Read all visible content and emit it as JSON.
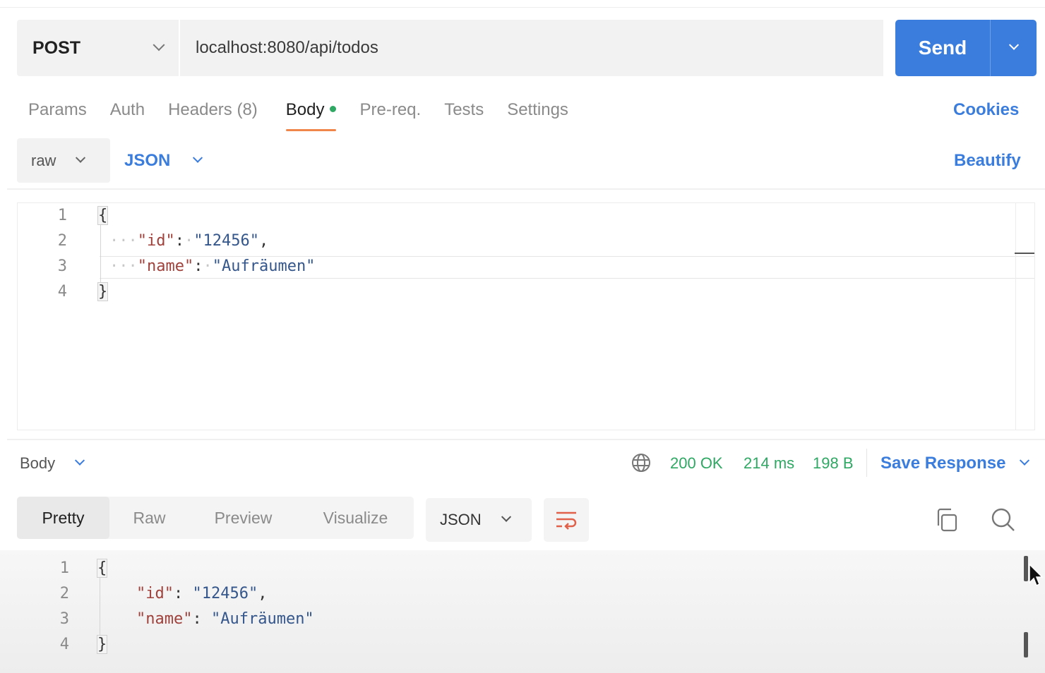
{
  "request": {
    "method": "POST",
    "url": "localhost:8080/api/todos",
    "send_label": "Send"
  },
  "request_tabs": [
    {
      "label": "Params",
      "active": false
    },
    {
      "label": "Auth",
      "active": false
    },
    {
      "label": "Headers (8)",
      "active": false
    },
    {
      "label": "Body",
      "active": true,
      "indicator_color": "#2fa864"
    },
    {
      "label": "Pre-req.",
      "active": false
    },
    {
      "label": "Tests",
      "active": false
    },
    {
      "label": "Settings",
      "active": false
    }
  ],
  "cookies_label": "Cookies",
  "body_options": {
    "mode": "raw",
    "language": "JSON",
    "beautify_label": "Beautify"
  },
  "request_body": {
    "line_numbers": [
      "1",
      "2",
      "3",
      "4"
    ],
    "open_brace": "{",
    "close_brace": "}",
    "fields": [
      {
        "key": "\"id\"",
        "value": "\"12456\"",
        "trailing": ","
      },
      {
        "key": "\"name\"",
        "value": "\"Aufräumen\"",
        "trailing": ""
      }
    ]
  },
  "response": {
    "section_label": "Body",
    "status": "200 OK",
    "time": "214 ms",
    "size": "198 B",
    "save_label": "Save Response",
    "view_tabs": [
      {
        "label": "Pretty",
        "active": true
      },
      {
        "label": "Raw",
        "active": false
      },
      {
        "label": "Preview",
        "active": false
      },
      {
        "label": "Visualize",
        "active": false
      }
    ],
    "format": "JSON",
    "line_numbers": [
      "1",
      "2",
      "3",
      "4"
    ],
    "open_brace": "{",
    "close_brace": "}",
    "fields": [
      {
        "key": "\"id\"",
        "value": "\"12456\"",
        "trailing": ","
      },
      {
        "key": "\"name\"",
        "value": "\"Aufräumen\"",
        "trailing": ""
      }
    ]
  },
  "colors": {
    "accent": "#3b7ddd",
    "active_tab_underline": "#f0864a",
    "status_ok": "#2fa864",
    "json_key": "#a0413b",
    "json_string": "#34568b"
  },
  "icons": {
    "method_dropdown": "chevron-down-icon",
    "send_dropdown": "chevron-down-icon",
    "network": "globe-icon",
    "wrap": "wrap-lines-icon",
    "copy": "copy-icon",
    "search": "search-icon"
  }
}
